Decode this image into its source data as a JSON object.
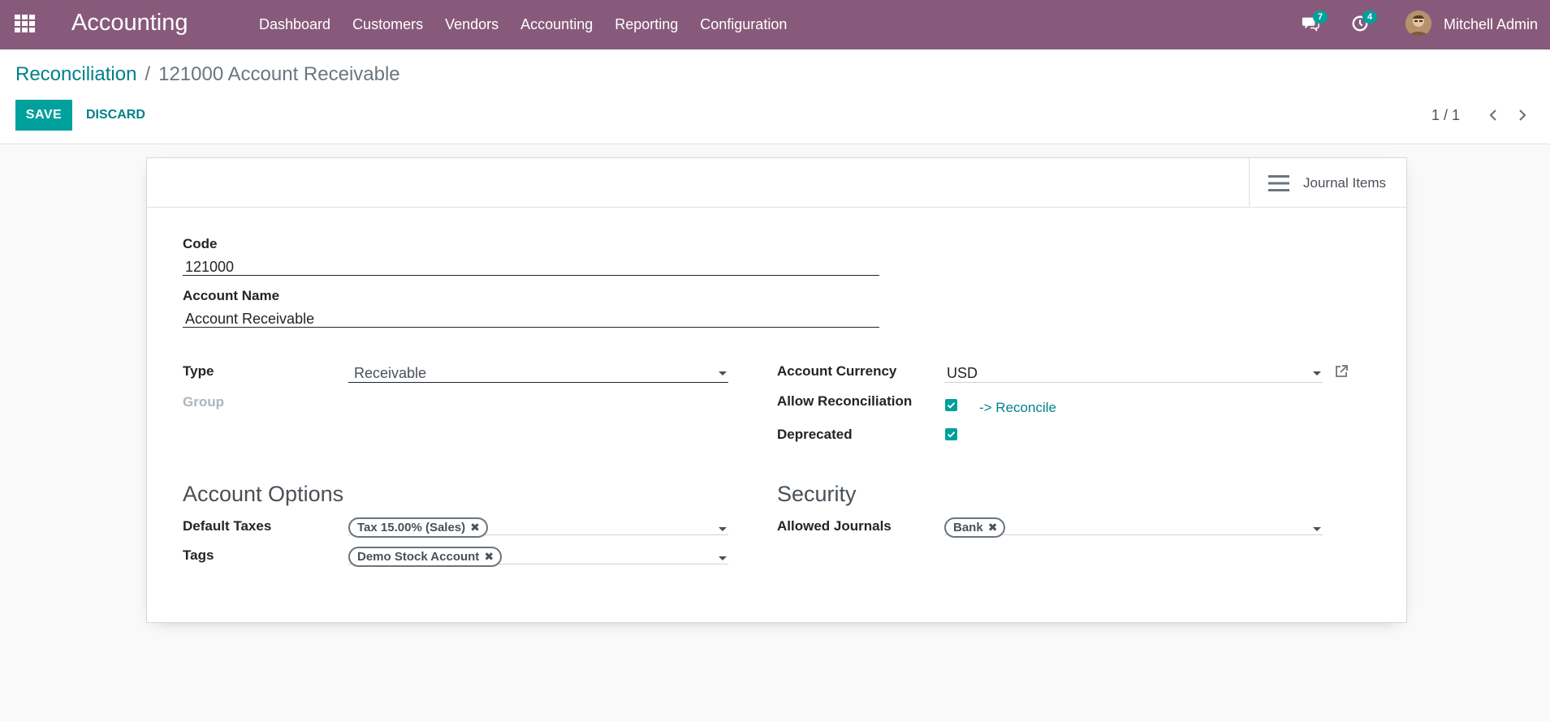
{
  "navbar": {
    "app_title": "Accounting",
    "menu": [
      "Dashboard",
      "Customers",
      "Vendors",
      "Accounting",
      "Reporting",
      "Configuration"
    ],
    "messages_count": "7",
    "activities_count": "4",
    "user_name": "Mitchell Admin"
  },
  "control": {
    "breadcrumb_parent": "Reconciliation",
    "breadcrumb_sep": "/",
    "breadcrumb_current": "121000 Account Receivable",
    "save_label": "SAVE",
    "discard_label": "DISCARD",
    "pager": "1 / 1"
  },
  "sheet": {
    "journal_items_label": "Journal Items",
    "code_label": "Code",
    "code_value": "121000",
    "name_label": "Account Name",
    "name_value": "Account Receivable",
    "type_label": "Type",
    "type_value": "Receivable",
    "group_label": "Group",
    "currency_label": "Account Currency",
    "currency_value": "USD",
    "allow_reconcile_label": "Allow Reconciliation",
    "allow_reconcile_checked": true,
    "reconcile_link": "-> Reconcile",
    "deprecated_label": "Deprecated",
    "deprecated_checked": true,
    "options_title": "Account Options",
    "default_taxes_label": "Default Taxes",
    "default_taxes_tag": "Tax 15.00% (Sales)",
    "tags_label": "Tags",
    "tags_tag": "Demo Stock Account",
    "security_title": "Security",
    "allowed_journals_label": "Allowed Journals",
    "allowed_journals_tag": "Bank"
  },
  "colors": {
    "navbar": "#875a7b",
    "primary": "#00a09d",
    "link": "#00818a"
  }
}
